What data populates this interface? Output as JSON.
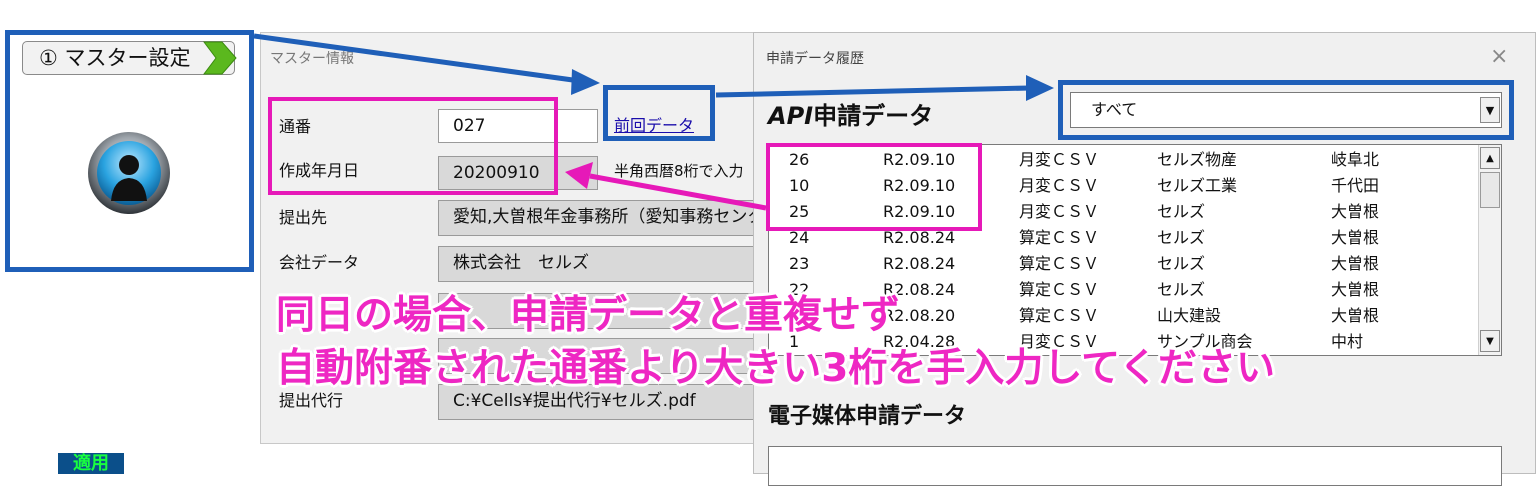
{
  "step_tab": {
    "label": "① マスター設定",
    "accent": "#5bb81e"
  },
  "master": {
    "title": "マスター情報",
    "serial_label": "通番",
    "serial_value": "027",
    "date_label": "作成年月日",
    "date_value": "20200910",
    "date_hint": "半角西暦8桁で入力",
    "submit_to_label": "提出先",
    "submit_to_value": "愛知,大曽根年金事務所（愛知事務センター）",
    "company_label": "会社データ",
    "company_value": "株式会社　セルズ",
    "agent_label": "提出代行",
    "agent_value": "C:¥Cells¥提出代行¥セルズ.pdf",
    "prev_link": "前回データ"
  },
  "history": {
    "title": "申請データ履歴",
    "close_glyph": "×",
    "api_heading_prefix": "API",
    "api_heading_rest": "申請データ",
    "filter_value": "すべて",
    "rows": [
      [
        "26",
        "R2.09.10",
        "月変ＣＳＶ",
        "セルズ物産",
        "岐阜北"
      ],
      [
        "10",
        "R2.09.10",
        "月変ＣＳＶ",
        "セルズ工業",
        "千代田"
      ],
      [
        "25",
        "R2.09.10",
        "月変ＣＳＶ",
        "セルズ",
        "大曽根"
      ],
      [
        "24",
        "R2.08.24",
        "算定ＣＳＶ",
        "セルズ",
        "大曽根"
      ],
      [
        "23",
        "R2.08.24",
        "算定ＣＳＶ",
        "セルズ",
        "大曽根"
      ],
      [
        "22",
        "R2.08.24",
        "算定ＣＳＶ",
        "セルズ",
        "大曽根"
      ],
      [
        "21",
        "R2.08.20",
        "算定ＣＳＶ",
        "山大建設",
        "大曽根"
      ],
      [
        "1",
        "R2.04.28",
        "月変ＣＳＶ",
        "サンプル商会",
        "中村"
      ]
    ],
    "media_heading": "電子媒体申請データ"
  },
  "caption": {
    "line1": "同日の場合、申請データと重複せず",
    "line2": "自動附番された通番より大きい3桁を手入力してください"
  },
  "bottom_icon_text": "適用",
  "colors": {
    "annotation_blue": "#1f5fb8",
    "annotation_pink": "#e619b8",
    "caption": "#ee27c3"
  }
}
